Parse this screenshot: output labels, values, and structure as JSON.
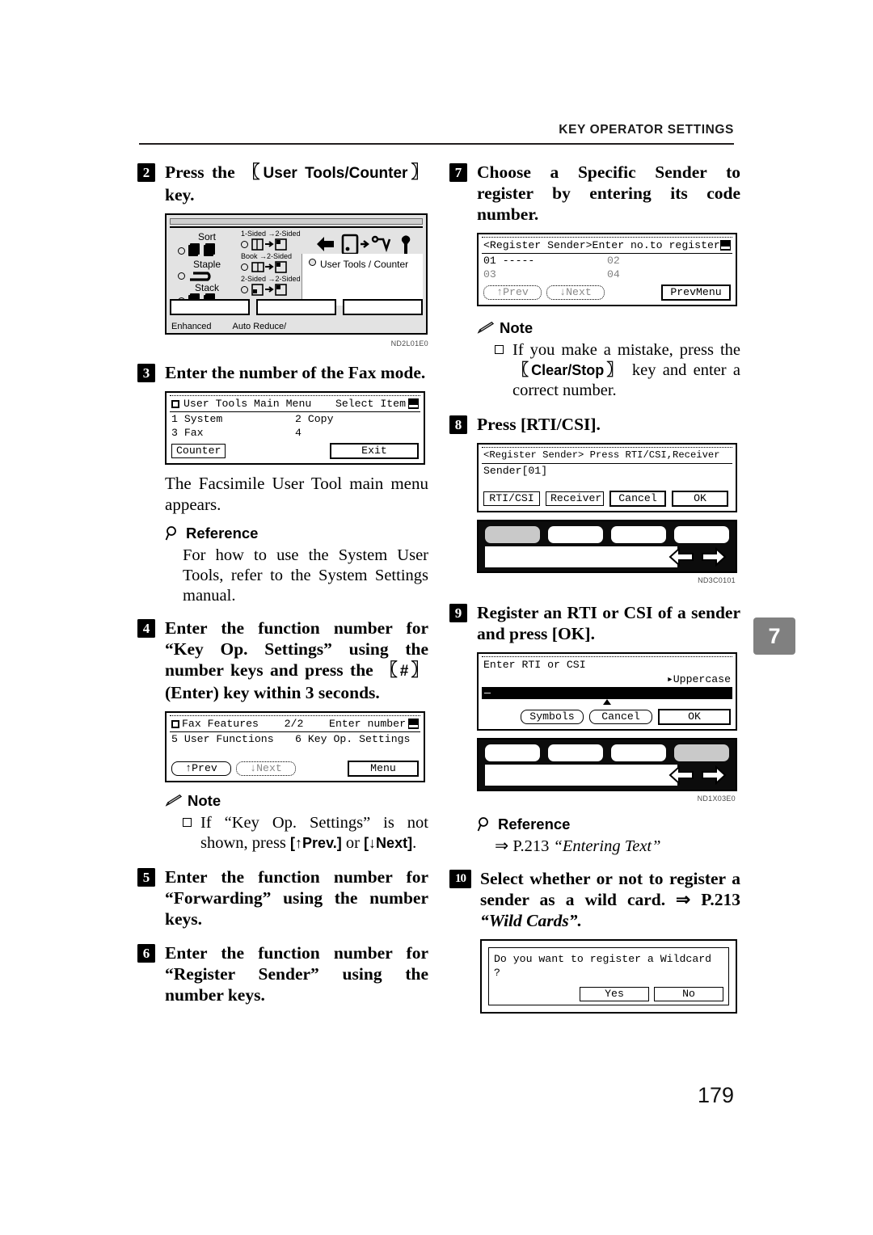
{
  "header": {
    "title": "KEY OPERATOR SETTINGS"
  },
  "page": {
    "number": "179",
    "chapter_tab": "7"
  },
  "steps": {
    "s2": {
      "number": "2",
      "text_before": "Press the ",
      "key": "User Tools/Counter",
      "text_after": " key.",
      "figure_code": "ND2L01E0"
    },
    "s3": {
      "number": "3",
      "text": "Enter the number of the Fax mode.",
      "caption": "The Facsimile User Tool main menu appears."
    },
    "s4": {
      "number": "4",
      "text_a": "Enter the function number for “Key Op. Settings” using the number keys and press the ",
      "key": "#",
      "text_b": " (Enter) key within 3 seconds."
    },
    "s5": {
      "number": "5",
      "text": "Enter the function number for “Forwarding” using the number keys."
    },
    "s6": {
      "number": "6",
      "text": "Enter the function number for “Register Sender” using the number keys."
    },
    "s7": {
      "number": "7",
      "text": "Choose a Specific Sender to register by entering its code number."
    },
    "s8": {
      "number": "8",
      "text": "Press [RTI/CSI].",
      "figure_code": "ND3C0101"
    },
    "s9": {
      "number": "9",
      "text": "Register an RTI or CSI of a sender and press [OK].",
      "figure_code": "ND1X03E0"
    },
    "s10": {
      "number": "10",
      "text_a": "Select whether or not to register a sender as a wild card. ",
      "arrow": "⇒",
      "text_b": " P.213",
      "text_c": "“Wild Cards”."
    }
  },
  "reference_1": {
    "label": "Reference",
    "body": "For how to use the System User Tools, refer to the System Settings manual."
  },
  "reference_2": {
    "label": "Reference",
    "arrow": "⇒",
    "page": " P.213 ",
    "title": "“Entering Text”"
  },
  "note_1": {
    "label": "Note",
    "text_a": "If “Key Op. Settings” is not shown, press ",
    "key_a": "[↑Prev.]",
    "text_b": " or ",
    "key_b": "[↓Next]",
    "text_c": "."
  },
  "note_2": {
    "label": "Note",
    "text_a": "If you make a mistake, press the ",
    "key": "Clear/Stop",
    "text_b": " key and enter a correct number."
  },
  "panel_figure": {
    "labels": {
      "sort": "Sort",
      "staple": "Staple",
      "stack": "Stack",
      "one_to_two": "1-Sided",
      "one_to_two_b": "2-Sided",
      "book_to_two": "Book",
      "book_to_two_b": "2-Sided",
      "two_to_two": "2-Sided",
      "two_to_two_b": "2-Sided",
      "user_tools_counter": "User Tools / Counter",
      "enhanced": "Enhanced",
      "auto_reduce": "Auto Reduce/"
    }
  },
  "lcd_user_tools_main_menu": {
    "title": "User Tools Main Menu",
    "title_right": "Select Item",
    "items": [
      {
        "left": "1 System",
        "right": "2 Copy"
      },
      {
        "left": "3 Fax",
        "right": "4"
      }
    ],
    "buttons": [
      {
        "label": "Counter",
        "style": "normal"
      },
      {
        "label": "Exit",
        "style": "bold"
      }
    ]
  },
  "lcd_fax_features": {
    "title": "Fax Features",
    "title_mid": "2/2",
    "title_right": "Enter number",
    "items": [
      {
        "left": "5 User Functions",
        "right": "6 Key Op. Settings"
      }
    ],
    "buttons": [
      {
        "label": "↑Prev",
        "style": "normal"
      },
      {
        "label": "↓Next",
        "style": "dim"
      },
      {
        "label": "Menu",
        "style": "bold"
      }
    ]
  },
  "lcd_register_sender_enter_no": {
    "title": "<Register Sender>Enter no.to register",
    "rows": [
      {
        "left": "01 -----",
        "right": "02"
      },
      {
        "left": "03",
        "right": "04"
      }
    ],
    "buttons": [
      {
        "label": "↑Prev",
        "style": "dim"
      },
      {
        "label": "↓Next",
        "style": "dim"
      },
      {
        "label": "PrevMenu",
        "style": "bold"
      }
    ]
  },
  "lcd_register_sender_press": {
    "title": "<Register Sender> Press RTI/CSI,Receiver",
    "line": "Sender[01]",
    "buttons": [
      {
        "label": "RTI/CSI",
        "style": "normal"
      },
      {
        "label": "Receiver",
        "style": "normal"
      },
      {
        "label": "Cancel",
        "style": "bold"
      },
      {
        "label": "OK",
        "style": "bold"
      }
    ]
  },
  "lcd_enter_rti_csi": {
    "title": "Enter RTI or CSI",
    "mode": "▸Uppercase",
    "buttons": [
      {
        "label": "Symbols",
        "style": "round"
      },
      {
        "label": "Cancel",
        "style": "round"
      },
      {
        "label": "OK",
        "style": "bold"
      }
    ]
  },
  "lcd_wildcard": {
    "question": "Do you want to register a Wildcard ?",
    "buttons": [
      {
        "label": "Yes",
        "style": "normal"
      },
      {
        "label": "No",
        "style": "normal"
      }
    ]
  }
}
